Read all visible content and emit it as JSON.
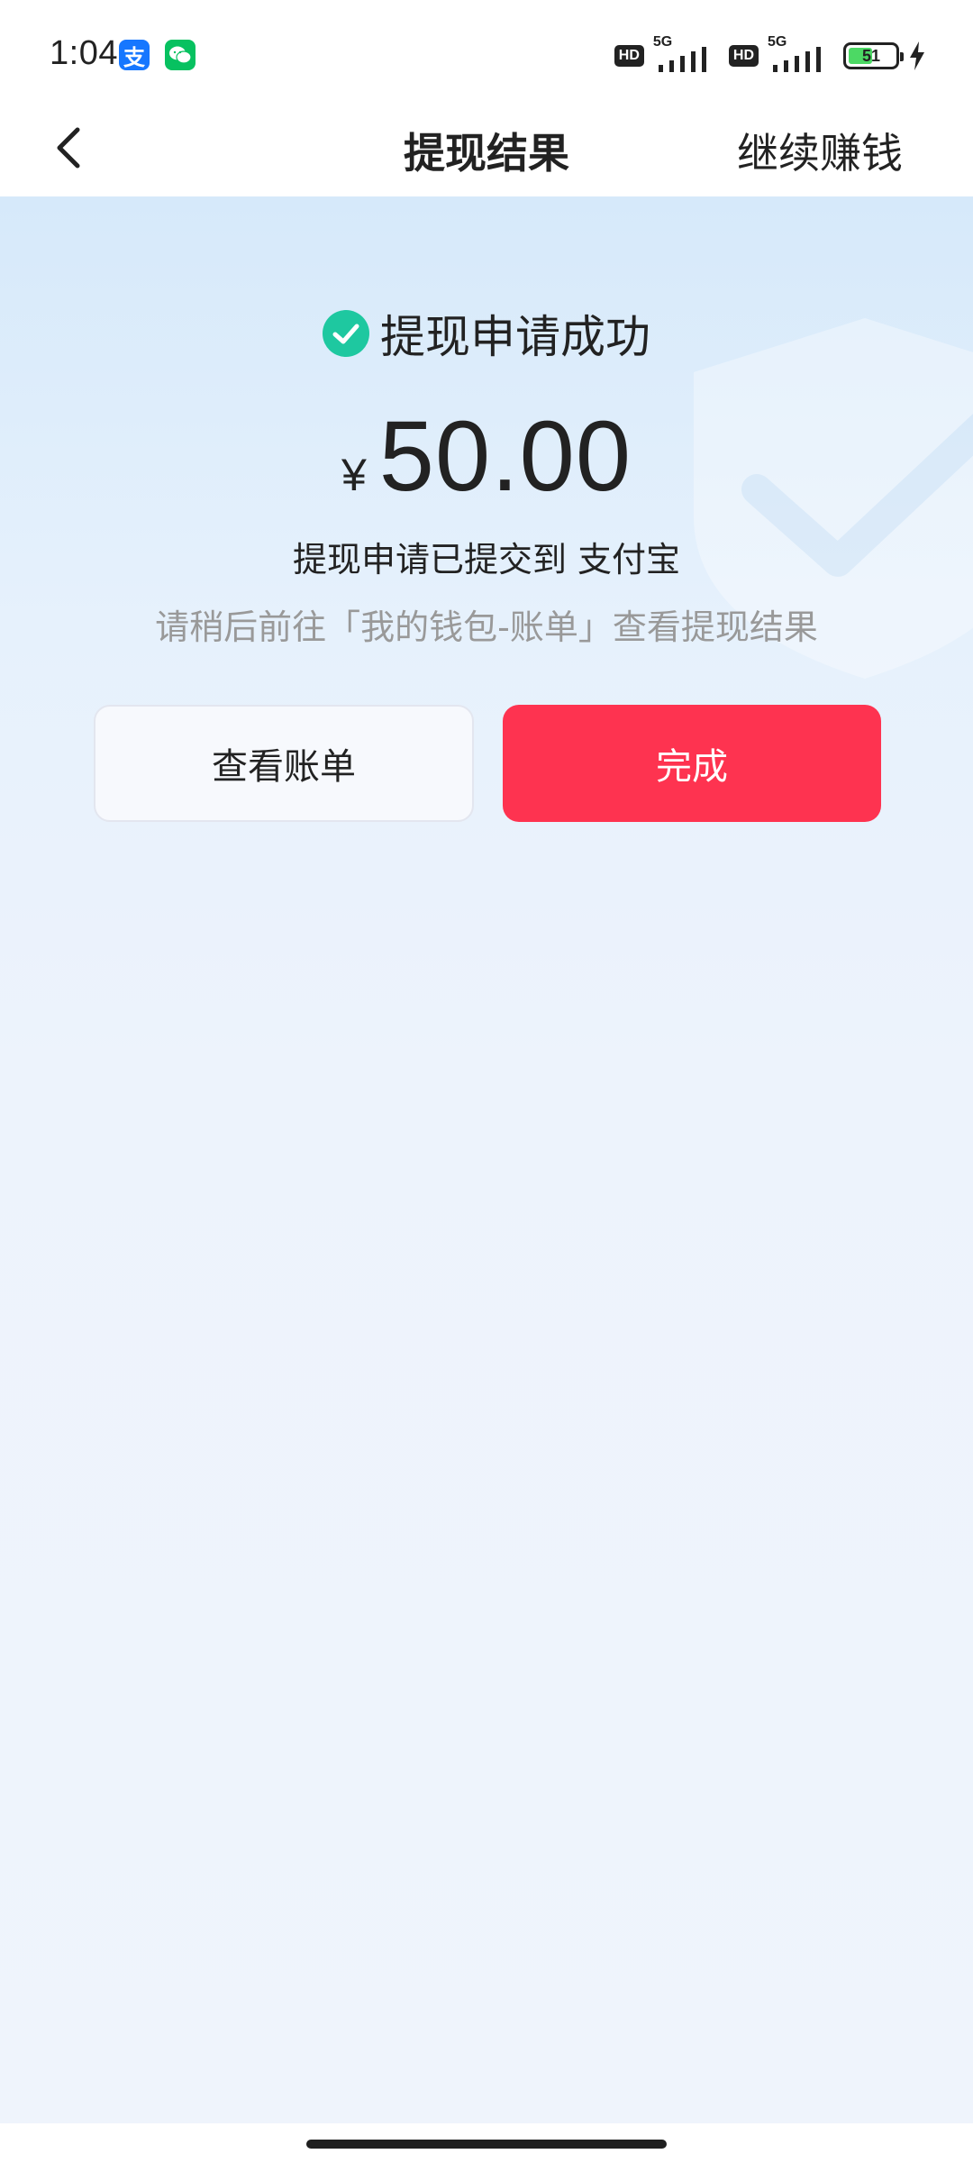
{
  "status_bar": {
    "time": "1:04",
    "alipay_glyph": "支",
    "wechat_icon": "wechat-icon",
    "hd_label": "HD",
    "network_label": "5G",
    "battery_level": "51",
    "battery_percent": 51,
    "charging_icon": "lightning-icon"
  },
  "nav": {
    "back_icon": "chevron-left-icon",
    "title": "提现结果",
    "action": "继续赚钱"
  },
  "result": {
    "status_icon": "check-circle-icon",
    "status_text": "提现申请成功",
    "currency_symbol": "¥",
    "amount": "50.00",
    "description": "提现申请已提交到 支付宝",
    "hint": "请稍后前往「我的钱包-账单」查看提现结果"
  },
  "buttons": {
    "view_bill": "查看账单",
    "done": "完成"
  },
  "colors": {
    "accent": "#fe3350",
    "success": "#1ec8a0",
    "alipay": "#1677ff",
    "wechat": "#07c160",
    "battery": "#4cd964"
  }
}
